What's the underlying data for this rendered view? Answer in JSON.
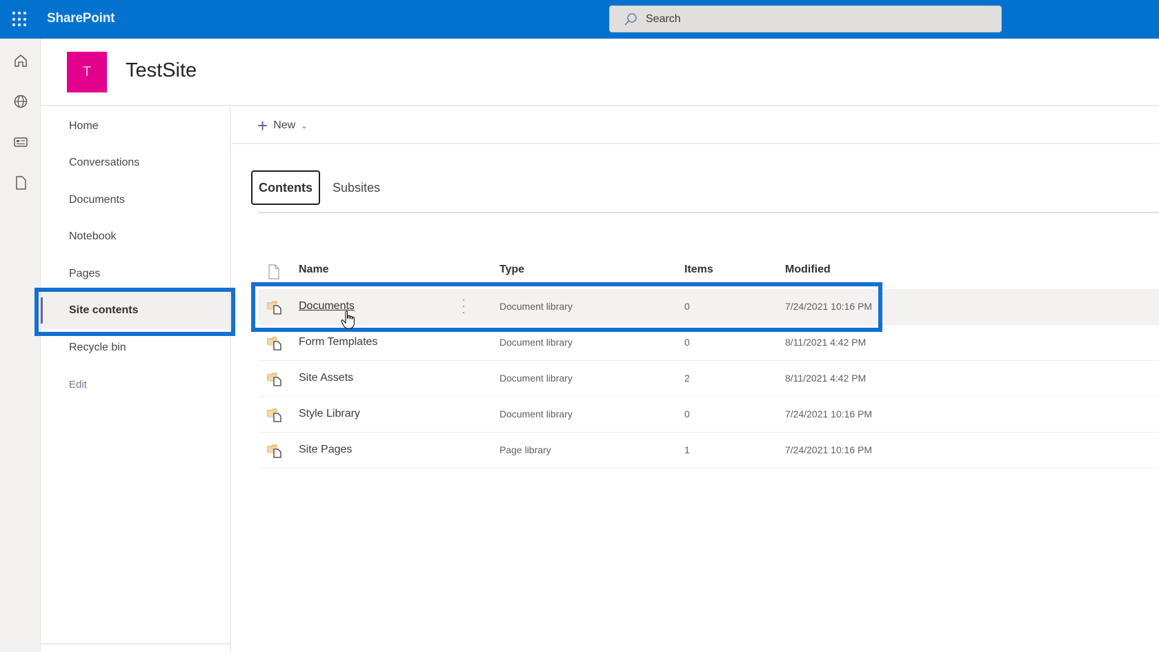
{
  "app": {
    "brand": "SharePoint",
    "search_placeholder": "Search"
  },
  "rail": {
    "icons": [
      "home-icon",
      "globe-icon",
      "news-icon",
      "file-icon"
    ]
  },
  "site": {
    "logo_letter": "T",
    "logo_color": "#e3008c",
    "title": "TestSite"
  },
  "nav": {
    "items": [
      {
        "label": "Home"
      },
      {
        "label": "Conversations"
      },
      {
        "label": "Documents"
      },
      {
        "label": "Notebook"
      },
      {
        "label": "Pages"
      },
      {
        "label": "Site contents",
        "selected": true
      },
      {
        "label": "Recycle bin"
      }
    ],
    "edit_label": "Edit"
  },
  "command_bar": {
    "new_label": "New"
  },
  "tabs": [
    {
      "label": "Contents",
      "active": true
    },
    {
      "label": "Subsites",
      "active": false
    }
  ],
  "table": {
    "columns": {
      "name": "Name",
      "type": "Type",
      "items": "Items",
      "modified": "Modified"
    },
    "rows": [
      {
        "name": "Documents",
        "type": "Document library",
        "items": "0",
        "modified": "7/24/2021 10:16 PM",
        "hovered": true
      },
      {
        "name": "Form Templates",
        "type": "Document library",
        "items": "0",
        "modified": "8/11/2021 4:42 PM"
      },
      {
        "name": "Site Assets",
        "type": "Document library",
        "items": "2",
        "modified": "8/11/2021 4:42 PM"
      },
      {
        "name": "Style Library",
        "type": "Document library",
        "items": "0",
        "modified": "7/24/2021 10:16 PM"
      },
      {
        "name": "Site Pages",
        "type": "Page library",
        "items": "1",
        "modified": "7/24/2021 10:16 PM"
      }
    ]
  },
  "colors": {
    "suite_bar": "#0372cf",
    "annotation_highlight": "#1470d3",
    "selected_nav_indicator": "#6e5fa0"
  }
}
